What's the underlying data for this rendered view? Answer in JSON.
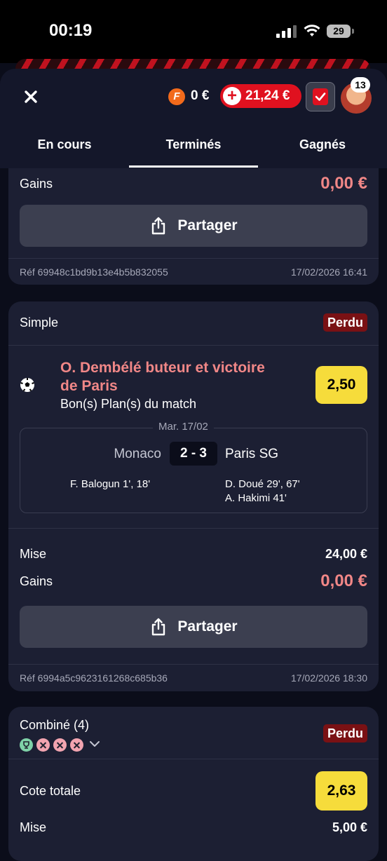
{
  "status_bar": {
    "time": "00:19",
    "battery": "29"
  },
  "header": {
    "freebet_icon_letter": "F",
    "freebet_balance": "0 €",
    "balance": "21,24 €",
    "notifications_count": "13",
    "icons": {
      "close": "close-icon",
      "freebet": "freebet-coin-icon",
      "deposit": "plus-icon",
      "betslip": "betslip-check-icon",
      "avatar": "user-avatar"
    }
  },
  "tabs": [
    {
      "label": "En cours",
      "selected": false
    },
    {
      "label": "Terminés",
      "selected": true
    },
    {
      "label": "Gagnés",
      "selected": false
    }
  ],
  "bet1": {
    "gains_label": "Gains",
    "gains_value": "0,00 €",
    "share_label": "Partager",
    "ref": "Réf 69948c1bd9b13e4b5b832055",
    "datetime": "17/02/2026 16:41"
  },
  "bet2": {
    "type": "Simple",
    "status": "Perdu",
    "sport_icon": "soccer-ball-icon",
    "selection_line1": "O. Dembélé buteur et victoire",
    "selection_line2": "de Paris",
    "market": "Bon(s) Plan(s) du match",
    "odd": "2,50",
    "match_date": "Mar. 17/02",
    "home_team": "Monaco",
    "score": "2 - 3",
    "away_team": "Paris SG",
    "home_scorers": [
      "F. Balogun 1', 18'"
    ],
    "away_scorers": [
      "D. Doué 29', 67'",
      "A. Hakimi 41'"
    ],
    "stake_label": "Mise",
    "stake_value": "24,00 €",
    "gains_label": "Gains",
    "gains_value": "0,00 €",
    "share_label": "Partager",
    "ref": "Réf 6994a5c9623161268c685b36",
    "datetime": "17/02/2026 18:30"
  },
  "bet3": {
    "type": "Combiné (4)",
    "status": "Perdu",
    "legs": [
      "won",
      "lost",
      "lost",
      "lost"
    ],
    "total_odd_label": "Cote totale",
    "total_odd": "2,63",
    "stake_label": "Mise",
    "stake_value": "5,00 €"
  },
  "colors": {
    "accent_red": "#e0111f",
    "loss_pink": "#f18787",
    "odd_yellow": "#f6dc3b",
    "card_bg": "#1c1f33",
    "lost_badge": "#7a1114"
  }
}
